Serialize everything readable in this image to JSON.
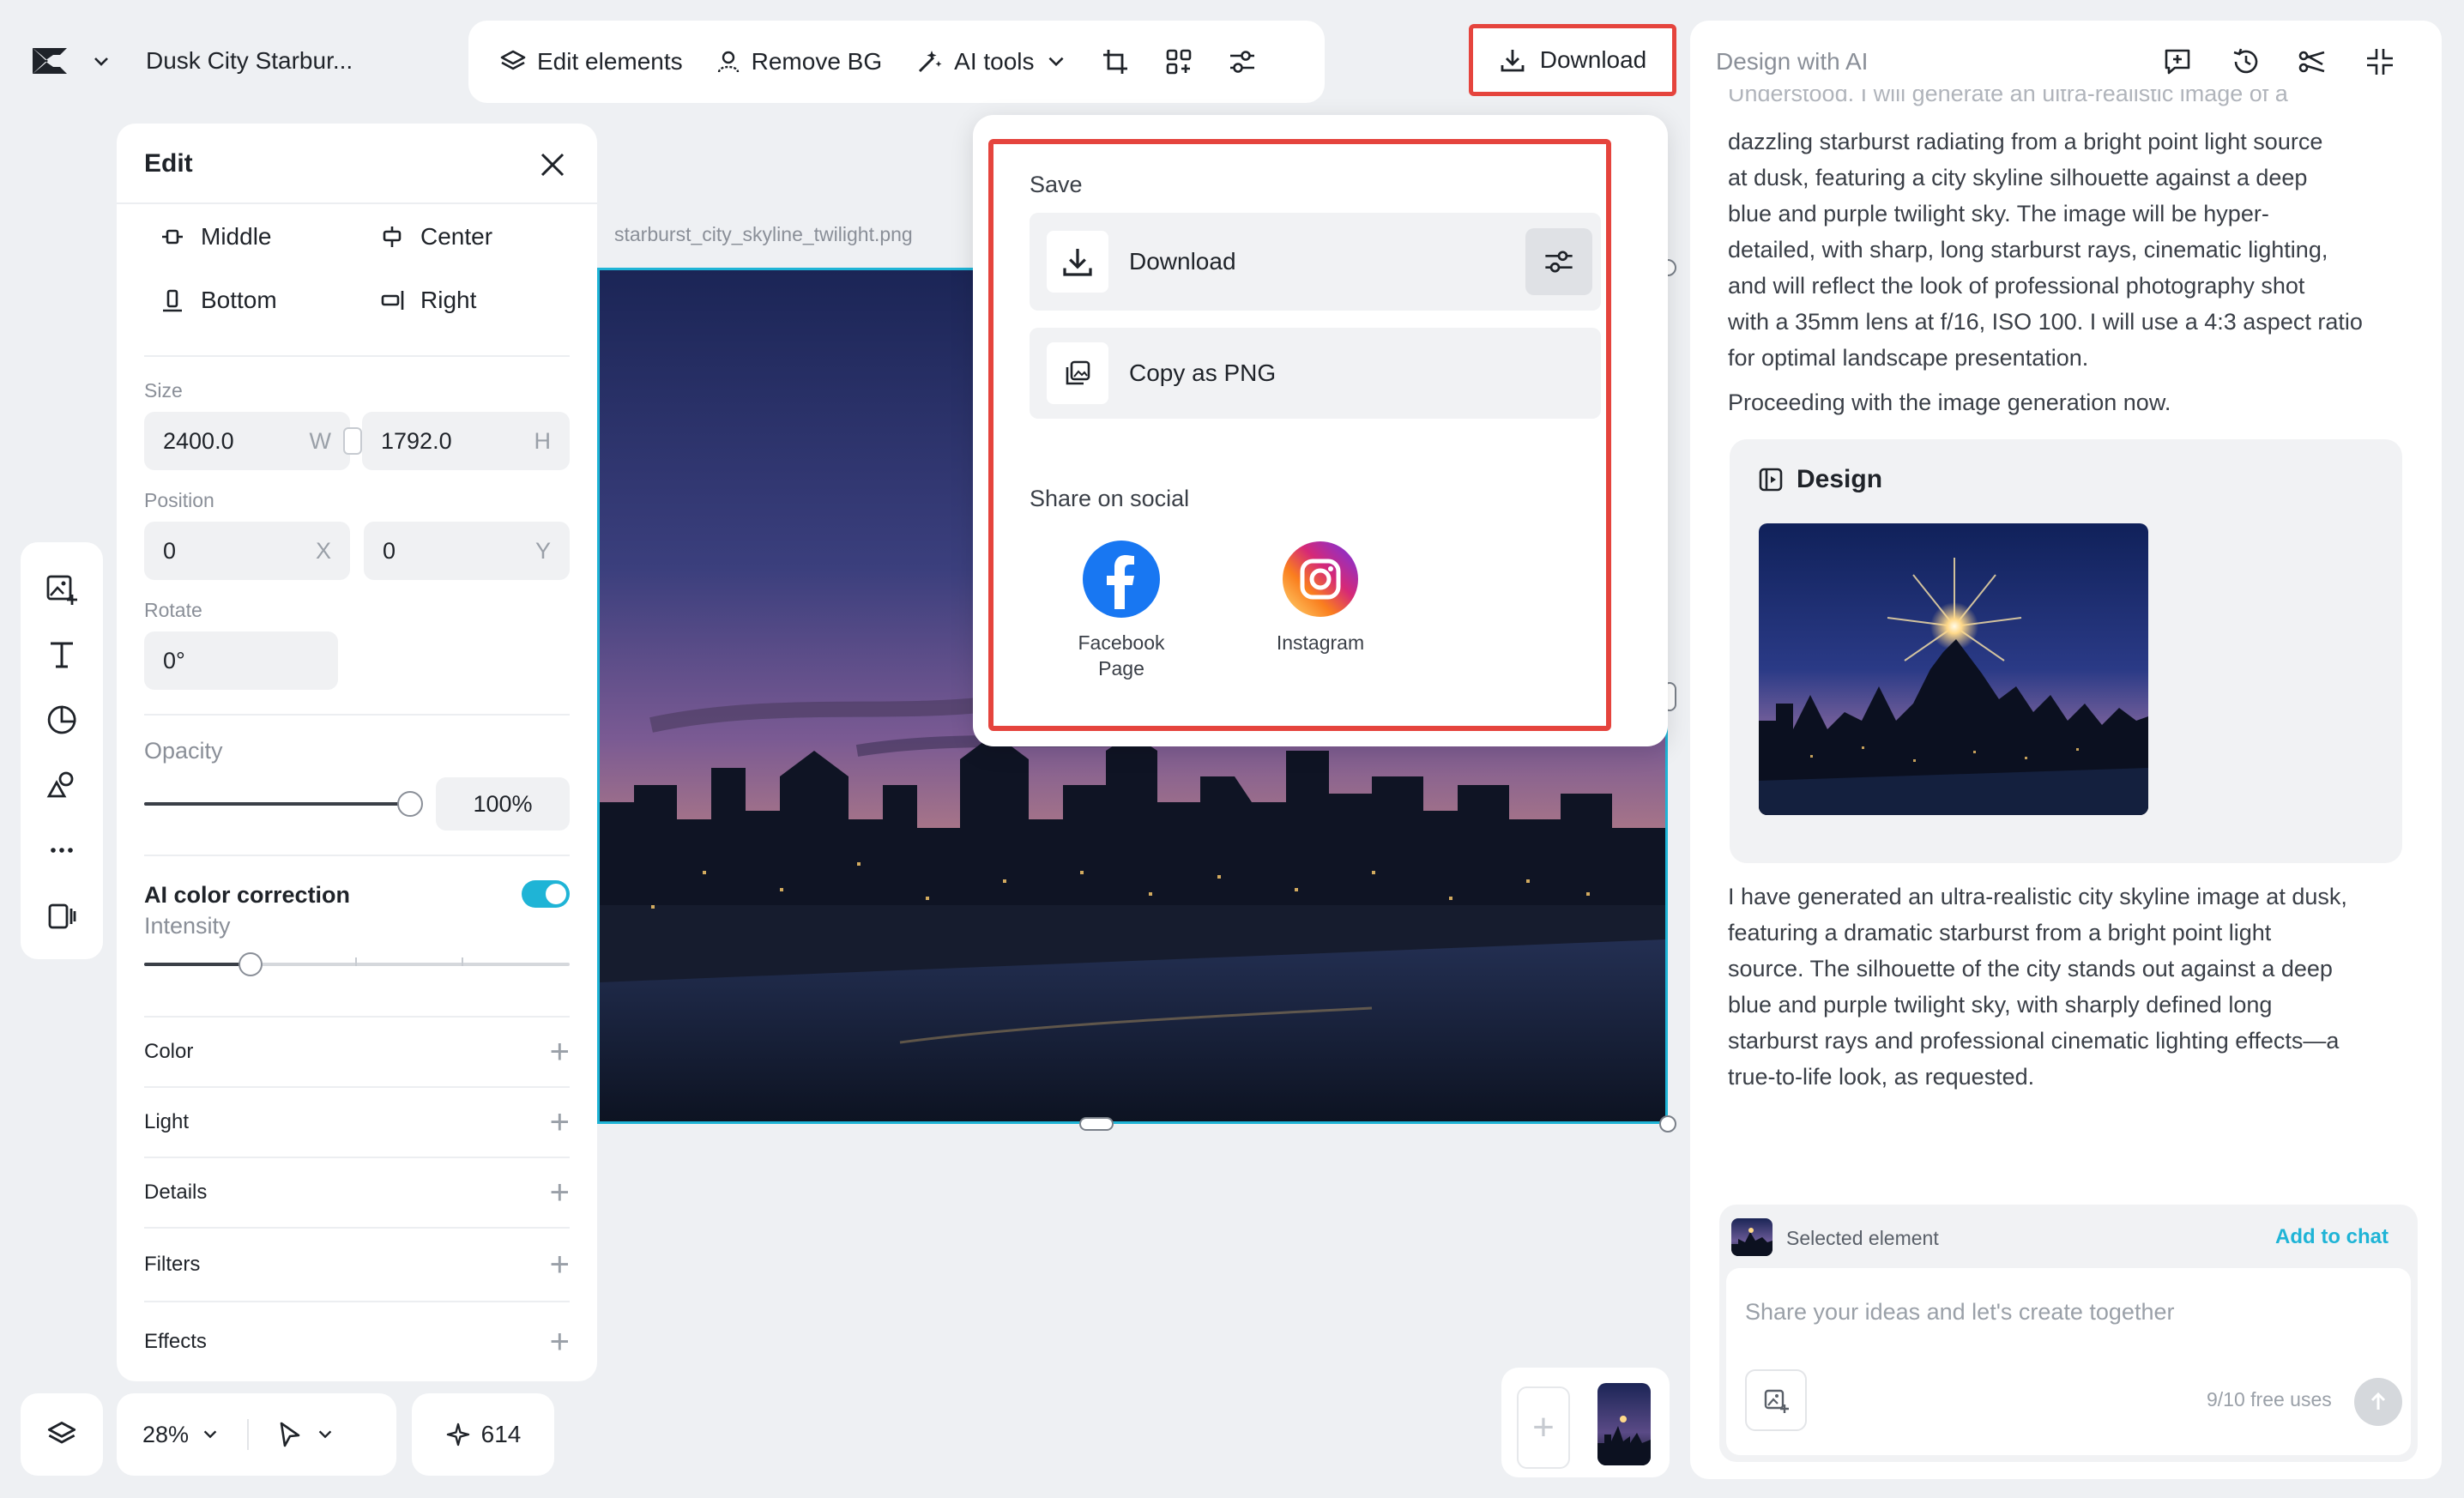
{
  "app": {
    "project_title": "Dusk City Starbur...",
    "brand_color": "#1fb4d6",
    "highlight_color": "#e5443d"
  },
  "toolbar": {
    "edit_elements": "Edit elements",
    "remove_bg": "Remove BG",
    "ai_tools": "AI tools",
    "download": "Download"
  },
  "edit_panel": {
    "title": "Edit",
    "align": {
      "middle": "Middle",
      "center": "Center",
      "bottom": "Bottom",
      "right": "Right"
    },
    "size_label": "Size",
    "width_value": "2400.0",
    "width_suffix": "W",
    "height_value": "1792.0",
    "height_suffix": "H",
    "position_label": "Position",
    "x_value": "0",
    "x_suffix": "X",
    "y_value": "0",
    "y_suffix": "Y",
    "rotate_label": "Rotate",
    "rotate_value": "0°",
    "opacity_label": "Opacity",
    "opacity_value": "100%",
    "opacity_level": 1.0,
    "ai_color_label": "AI color correction",
    "ai_color_enabled": true,
    "intensity_label": "Intensity",
    "intensity_level": 0.25,
    "sections": [
      "Color",
      "Light",
      "Details",
      "Filters",
      "Effects"
    ]
  },
  "canvas": {
    "filename": "starburst_city_skyline_twilight.png"
  },
  "download_popup": {
    "save_label": "Save",
    "download_label": "Download",
    "copy_label": "Copy as PNG",
    "share_label": "Share on social",
    "facebook_label_line1": "Facebook",
    "facebook_label_line2": "Page",
    "instagram_label": "Instagram"
  },
  "bottom_bar": {
    "zoom": "28%",
    "credits": "614"
  },
  "ai_panel": {
    "title": "Design with AI",
    "message_1_cut": "Understood. I will generate an ultra-realistic image of a",
    "message_1_lines": [
      "dazzling starburst radiating from a bright point light source",
      "at dusk, featuring a city skyline silhouette against a deep",
      "blue and purple twilight sky. The image will be hyper-",
      "detailed, with sharp, long starburst rays, cinematic lighting,",
      "and will reflect the look of professional photography shot",
      "with a 35mm lens at f/16, ISO 100. I will use a 4:3 aspect ratio",
      "for optimal landscape presentation."
    ],
    "message_2": "Proceeding with the image generation now.",
    "design_card_title": "Design",
    "message_3_lines": [
      "I have generated an ultra-realistic city skyline image at dusk,",
      "featuring a dramatic starburst from a bright point light",
      "source. The silhouette of the city stands out against a deep",
      "blue and purple twilight sky, with sharply defined long",
      "starburst rays and professional cinematic lighting effects—a",
      "true-to-life look, as requested."
    ],
    "selected_element_label": "Selected element",
    "add_to_chat": "Add to chat",
    "chat_placeholder": "Share your ideas and let's create together",
    "free_uses": "9/10 free uses"
  }
}
